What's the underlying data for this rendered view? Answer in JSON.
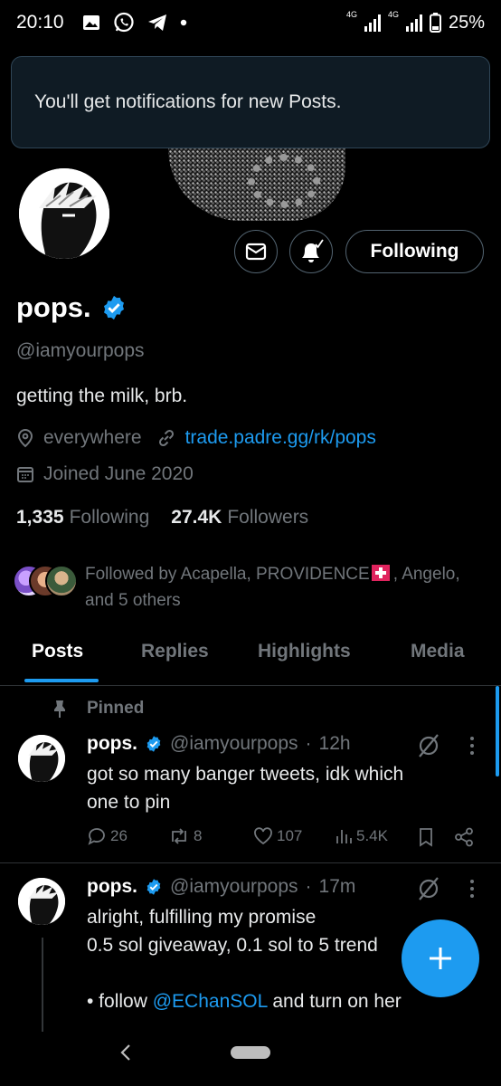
{
  "status_bar": {
    "time": "20:10",
    "network_1": "4G",
    "network_2": "4G",
    "battery": "25%",
    "icons": [
      "gallery-icon",
      "whatsapp-icon",
      "telegram-icon",
      "dot-icon",
      "signal-icon",
      "battery-icon"
    ]
  },
  "toast": {
    "message": "You'll get notifications for new Posts."
  },
  "profile": {
    "display_name": "pops.",
    "handle": "@iamyourpops",
    "bio": "getting the milk, brb.",
    "location": "everywhere",
    "website": "trade.padre.gg/rk/pops",
    "joined": "Joined June 2020",
    "following_count": "1,335",
    "following_label": "Following",
    "followers_count": "27.4K",
    "followers_label": "Followers",
    "follow_button_label": "Following",
    "followed_by_prefix": "Followed by Acapella, PROVIDENCE",
    "followed_by_suffix": ", Angelo,",
    "followed_by_more": "and 5 others"
  },
  "tabs": [
    "Posts",
    "Replies",
    "Highlights",
    "Media"
  ],
  "active_tab": "Posts",
  "pinned_label": "Pinned",
  "posts": [
    {
      "name": "pops.",
      "handle": "@iamyourpops",
      "separator": "·",
      "time": "12h",
      "text": "got so many banger tweets, idk which\none to pin",
      "replies": "26",
      "reposts": "8",
      "likes": "107",
      "views": "5.4K"
    },
    {
      "name": "pops.",
      "handle": "@iamyourpops",
      "separator": "·",
      "time": "17m",
      "text_line1": "alright, fulfilling my promise",
      "text_line2": "0.5 sol giveaway, 0.1 sol to 5 trend",
      "text_bullet": "• follow ",
      "mention": "@EChanSOL",
      "text_after_mention": " and turn on her"
    }
  ],
  "colors": {
    "accent": "#1d9bf0",
    "background": "#000000",
    "secondary_text": "#71767b",
    "toast_bg": "#0f1b24"
  }
}
